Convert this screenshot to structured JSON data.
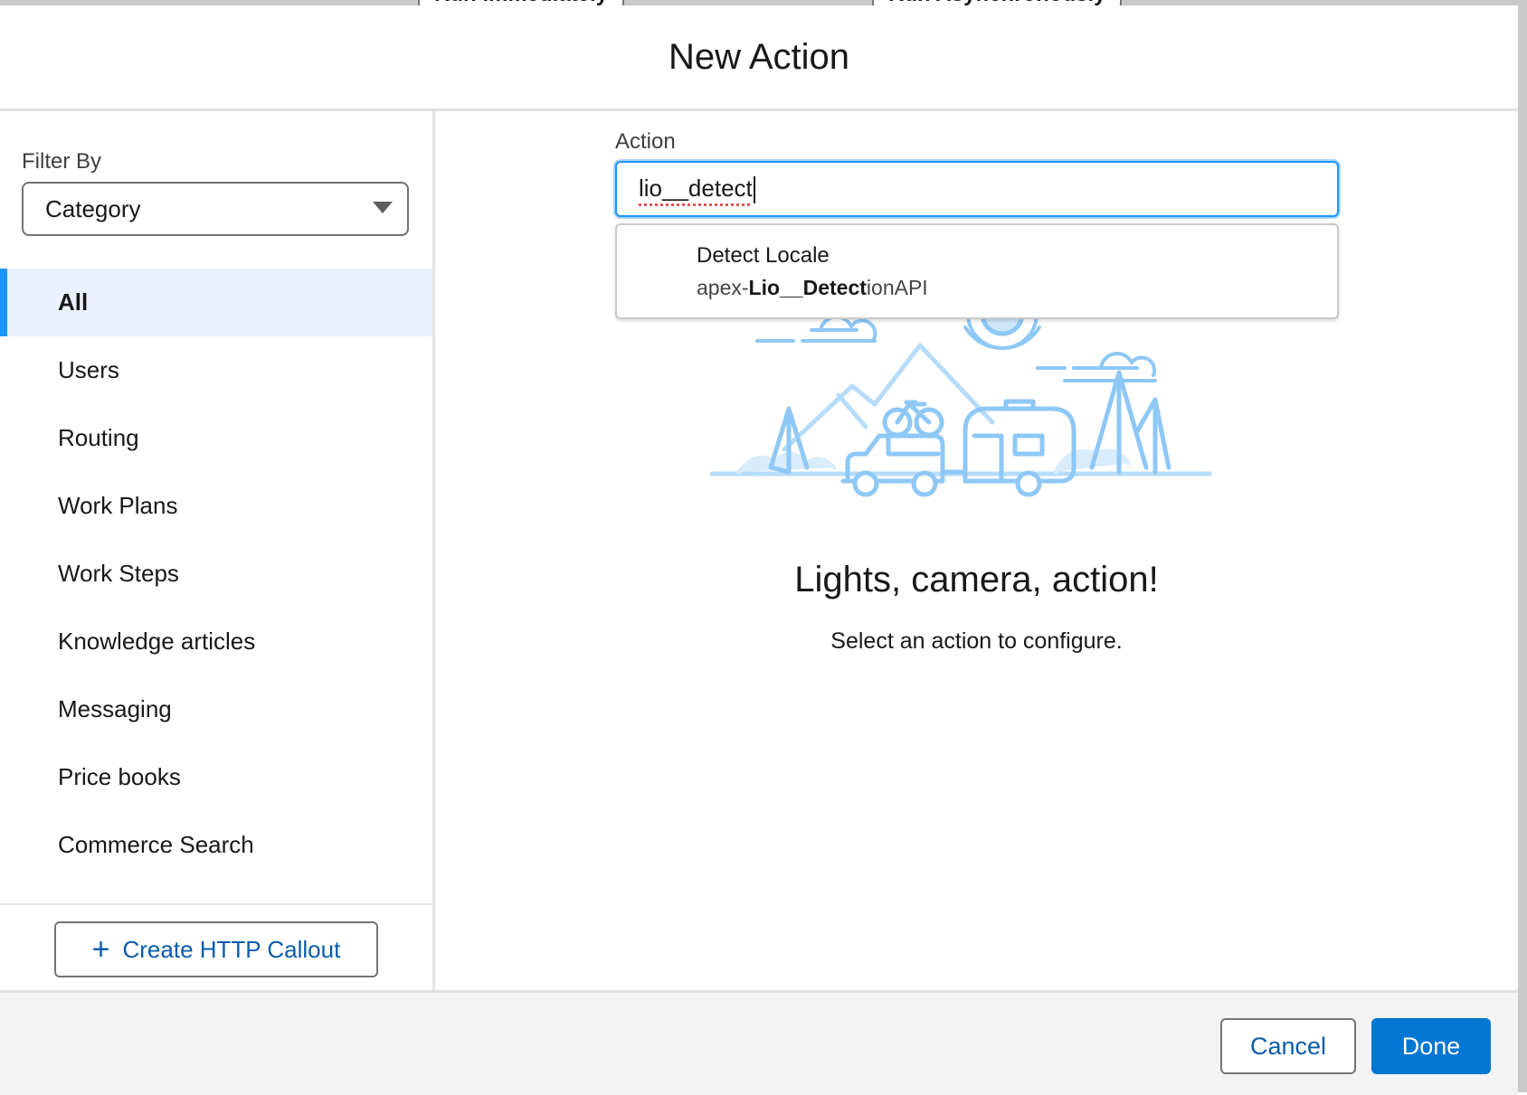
{
  "background": {
    "button_left": "Run Immediately",
    "button_right": "Run Asynchronously"
  },
  "modal": {
    "title": "New Action"
  },
  "sidebar": {
    "filter_label": "Filter By",
    "filter_value": "Category",
    "categories": [
      {
        "label": "All",
        "active": true
      },
      {
        "label": "Users"
      },
      {
        "label": "Routing"
      },
      {
        "label": "Work Plans"
      },
      {
        "label": "Work Steps"
      },
      {
        "label": "Knowledge articles"
      },
      {
        "label": "Messaging"
      },
      {
        "label": "Price books"
      },
      {
        "label": "Commerce Search"
      }
    ],
    "create_button": "Create HTTP Callout"
  },
  "main": {
    "action_label": "Action",
    "search_value": "lio__detect",
    "results": [
      {
        "title": "Detect Locale",
        "subtitle_prefix": "apex-",
        "subtitle_match": "Lio__Detect",
        "subtitle_suffix": "ionAPI"
      }
    ],
    "empty_title": "Lights, camera, action!",
    "empty_subtitle": "Select an action to configure."
  },
  "footer": {
    "cancel_label": "Cancel",
    "done_label": "Done"
  },
  "colors": {
    "brand": "#0176d3",
    "link": "#0b5cab",
    "active_bg": "#eaf1fd",
    "active_bar": "#1b96ff",
    "illustration": "#8ec8f6"
  }
}
